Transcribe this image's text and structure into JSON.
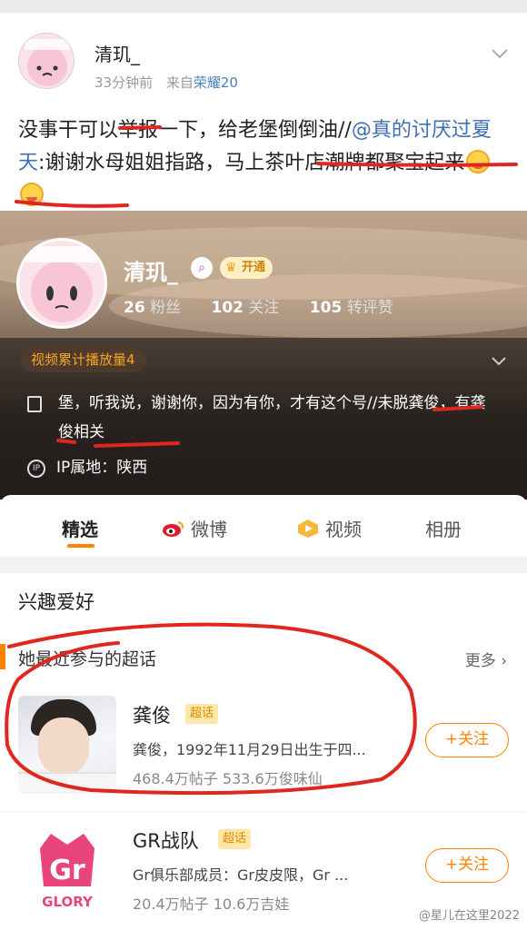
{
  "post": {
    "author": "清玑_",
    "time": "33分钟前",
    "from_label": "来自",
    "device": "荣耀20",
    "text_a": "没事干可以举报一下，给老堡倒倒油//",
    "mention": "@真的讨厌过夏天",
    "text_b": ":谢谢水母姐姐指路，马上茶叶店潮牌都聚宝起来"
  },
  "profile": {
    "name": "清玑_",
    "vip_label": "开通",
    "fans_count": "26",
    "fans_label": "粉丝",
    "follow_count": "102",
    "follow_label": "关注",
    "reposts_count": "105",
    "reposts_label": "转评赞",
    "video_pill": "视频累计播放量4",
    "bio": "堡，听我说，谢谢你，因为有你，才有这个号//未脱龚俊，有龚俊相关",
    "ip": "IP属地：陕西"
  },
  "tabs": [
    {
      "label": "精选",
      "active": true,
      "icon": "none"
    },
    {
      "label": "微博",
      "active": false,
      "icon": "weibo-icon"
    },
    {
      "label": "视频",
      "active": false,
      "icon": "video-icon"
    },
    {
      "label": "相册",
      "active": false,
      "icon": "none"
    }
  ],
  "interests": {
    "title": "兴趣爱好",
    "subtitle": "她最近参与的超话",
    "more": "更多 ›",
    "topics": [
      {
        "name": "龚俊",
        "tag": "超话",
        "desc": "龚俊，1992年11月29日出生于四...",
        "stats": "468.4万帖子 533.6万俊味仙",
        "follow": "+关注"
      },
      {
        "name": "GR战队",
        "tag": "超话",
        "desc": "Gr俱乐部成员：Gr皮皮限，Gr ...",
        "stats": "20.4万帖子 10.6万吉娃",
        "follow": "+关注",
        "logo_text": "GLORY"
      }
    ]
  },
  "watermark": "@星儿在这里2022",
  "colors": {
    "accent": "#ff8200",
    "link": "#3d6fb5",
    "annotation": "#e0271f"
  }
}
